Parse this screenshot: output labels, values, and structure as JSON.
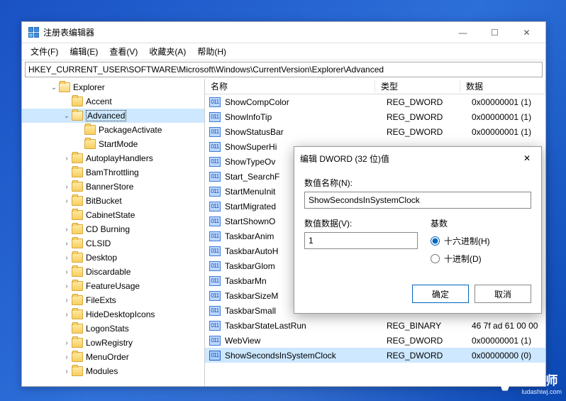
{
  "app": {
    "title": "注册表编辑器",
    "minimize": "—",
    "maximize": "☐",
    "close": "✕"
  },
  "menu": {
    "file": "文件(F)",
    "edit": "编辑(E)",
    "view": "查看(V)",
    "favorites": "收藏夹(A)",
    "help": "帮助(H)"
  },
  "address": "HKEY_CURRENT_USER\\SOFTWARE\\Microsoft\\Windows\\CurrentVersion\\Explorer\\Advanced",
  "columns": {
    "name": "名称",
    "type": "类型",
    "data": "数据"
  },
  "tree": {
    "explorer": "Explorer",
    "accent": "Accent",
    "advanced": "Advanced",
    "packageActivate": "PackageActivate",
    "startMode": "StartMode",
    "autoplayHandlers": "AutoplayHandlers",
    "bamThrottling": "BamThrottling",
    "bannerStore": "BannerStore",
    "bitBucket": "BitBucket",
    "cabinetState": "CabinetState",
    "cdBurning": "CD Burning",
    "clsid": "CLSID",
    "desktop": "Desktop",
    "discardable": "Discardable",
    "featureUsage": "FeatureUsage",
    "fileExts": "FileExts",
    "hideDesktopIcons": "HideDesktopIcons",
    "logonStats": "LogonStats",
    "lowRegistry": "LowRegistry",
    "menuOrder": "MenuOrder",
    "modules": "Modules"
  },
  "values": [
    {
      "name": "ShowCompColor",
      "type": "REG_DWORD",
      "data": "0x00000001 (1)"
    },
    {
      "name": "ShowInfoTip",
      "type": "REG_DWORD",
      "data": "0x00000001 (1)"
    },
    {
      "name": "ShowStatusBar",
      "type": "REG_DWORD",
      "data": "0x00000001 (1)"
    },
    {
      "name": "ShowSuperHi",
      "type": "",
      "data": ""
    },
    {
      "name": "ShowTypeOv",
      "type": "",
      "data": ""
    },
    {
      "name": "Start_SearchF",
      "type": "",
      "data": ""
    },
    {
      "name": "StartMenuInit",
      "type": "",
      "data": ""
    },
    {
      "name": "StartMigrated",
      "type": "",
      "data": ""
    },
    {
      "name": "StartShownO",
      "type": "",
      "data": ""
    },
    {
      "name": "TaskbarAnim",
      "type": "",
      "data": ""
    },
    {
      "name": "TaskbarAutoH",
      "type": "",
      "data": ""
    },
    {
      "name": "TaskbarGlom",
      "type": "",
      "data": ""
    },
    {
      "name": "TaskbarMn",
      "type": "",
      "data": ""
    },
    {
      "name": "TaskbarSizeM",
      "type": "",
      "data": ""
    },
    {
      "name": "TaskbarSmall",
      "type": "",
      "data": ""
    },
    {
      "name": "TaskbarStateLastRun",
      "type": "REG_BINARY",
      "data": "46 7f ad 61 00 00"
    },
    {
      "name": "WebView",
      "type": "REG_DWORD",
      "data": "0x00000001 (1)"
    },
    {
      "name": "ShowSecondsInSystemClock",
      "type": "REG_DWORD",
      "data": "0x00000000 (0)",
      "selected": true
    }
  ],
  "dialog": {
    "title": "编辑 DWORD (32 位)值",
    "close": "✕",
    "nameLabel": "数值名称(N):",
    "nameValue": "ShowSecondsInSystemClock",
    "dataLabel": "数值数据(V):",
    "dataValue": "1",
    "radixLabel": "基数",
    "hex": "十六进制(H)",
    "dec": "十进制(D)",
    "ok": "确定",
    "cancel": "取消"
  },
  "watermark": {
    "cn": "鹿大师",
    "en": "ludashiwj.com"
  }
}
